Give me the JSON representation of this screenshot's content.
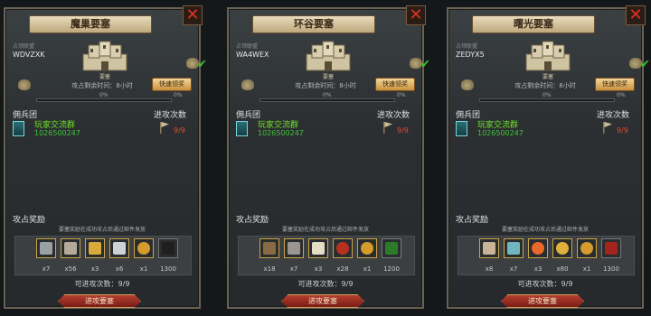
{
  "panels": [
    {
      "title": "魔巢要塞",
      "owner_label": "占领联盟",
      "owner_code": "WDVZXK",
      "fortress_caption": "要塞",
      "timer_text": "攻占剩余时间：8小时",
      "fast_button": "快速领奖",
      "progress_left": "0%",
      "progress_right": "0%",
      "progress_fraction": 0.0,
      "merc_section": "佣兵团",
      "attack_count_label": "进攻次数",
      "merc_name": "玩家交流群",
      "merc_id": "1026500247",
      "merc_count": "9/9",
      "reward_section": "攻占奖励",
      "reward_hint": "要塞奖励在成功攻占后通过邮件发放",
      "items": [
        {
          "icon": "silver-ingot-icon",
          "count": "x7",
          "color": "#9aa0a4"
        },
        {
          "icon": "stone-icon",
          "count": "x56",
          "color": "#b3aa9a"
        },
        {
          "icon": "gold-bars-icon",
          "count": "x3",
          "color": "#d9a93a"
        },
        {
          "icon": "crystal-icon",
          "count": "x6",
          "color": "#c9d3d8"
        },
        {
          "icon": "gold-coin-icon",
          "count": "x1",
          "color": "#d49b2d"
        },
        {
          "icon": "banner-icon",
          "count": "1300",
          "color": "#1f1f1f"
        }
      ],
      "attempts_text": "可进攻次数：9/9",
      "attack_button": "进攻要塞"
    },
    {
      "title": "环谷要塞",
      "owner_label": "占领联盟",
      "owner_code": "WA4WEX",
      "fortress_caption": "要塞",
      "timer_text": "攻占剩余时间：8小时",
      "fast_button": "快速领奖",
      "progress_left": "0%",
      "progress_right": "0%",
      "progress_fraction": 0.0,
      "merc_section": "佣兵团",
      "attack_count_label": "进攻次数",
      "merc_name": "玩家交流群",
      "merc_id": "1026500247",
      "merc_count": "9/9",
      "reward_section": "攻占奖励",
      "reward_hint": "要塞奖励在成功攻占后通过邮件发放",
      "items": [
        {
          "icon": "wood-log-icon",
          "count": "x18",
          "color": "#8a6a45"
        },
        {
          "icon": "stone-icon",
          "count": "x7",
          "color": "#9a9590"
        },
        {
          "icon": "bread-icon",
          "count": "x3",
          "color": "#e6ddc5"
        },
        {
          "icon": "berries-icon",
          "count": "x28",
          "color": "#b8301f"
        },
        {
          "icon": "gold-coin-icon",
          "count": "x1",
          "color": "#d49b2d"
        },
        {
          "icon": "green-banner-icon",
          "count": "1200",
          "color": "#2d7a2a"
        }
      ],
      "attempts_text": "可进攻次数：9/9",
      "attack_button": "进攻要塞"
    },
    {
      "title": "曙光要塞",
      "owner_label": "占领联盟",
      "owner_code": "ZEDYX5",
      "fortress_caption": "要塞",
      "timer_text": "攻占剩余时间：8小时",
      "fast_button": "快速领奖",
      "progress_left": "0%",
      "progress_right": "0%",
      "progress_fraction": 0.0,
      "merc_section": "佣兵团",
      "attack_count_label": "进攻次数",
      "merc_name": "玩家交流群",
      "merc_id": "1026500247",
      "merc_count": "9/9",
      "reward_section": "攻占奖励",
      "reward_hint": "要塞奖励在成功攻占后通过邮件发放",
      "items": [
        {
          "icon": "horse-icon",
          "count": "x8",
          "color": "#c9b596"
        },
        {
          "icon": "cloth-roll-icon",
          "count": "x7",
          "color": "#6fb7c0"
        },
        {
          "icon": "orange-gems-icon",
          "count": "x3",
          "color": "#e8692a"
        },
        {
          "icon": "gold-coin-pile-icon",
          "count": "x80",
          "color": "#e0b03a"
        },
        {
          "icon": "gold-coin-icon",
          "count": "x1",
          "color": "#d49b2d"
        },
        {
          "icon": "red-banner-icon",
          "count": "1300",
          "color": "#a3241c"
        }
      ],
      "attempts_text": "可进攻次数：9/9",
      "attack_button": "进攻要塞"
    }
  ]
}
